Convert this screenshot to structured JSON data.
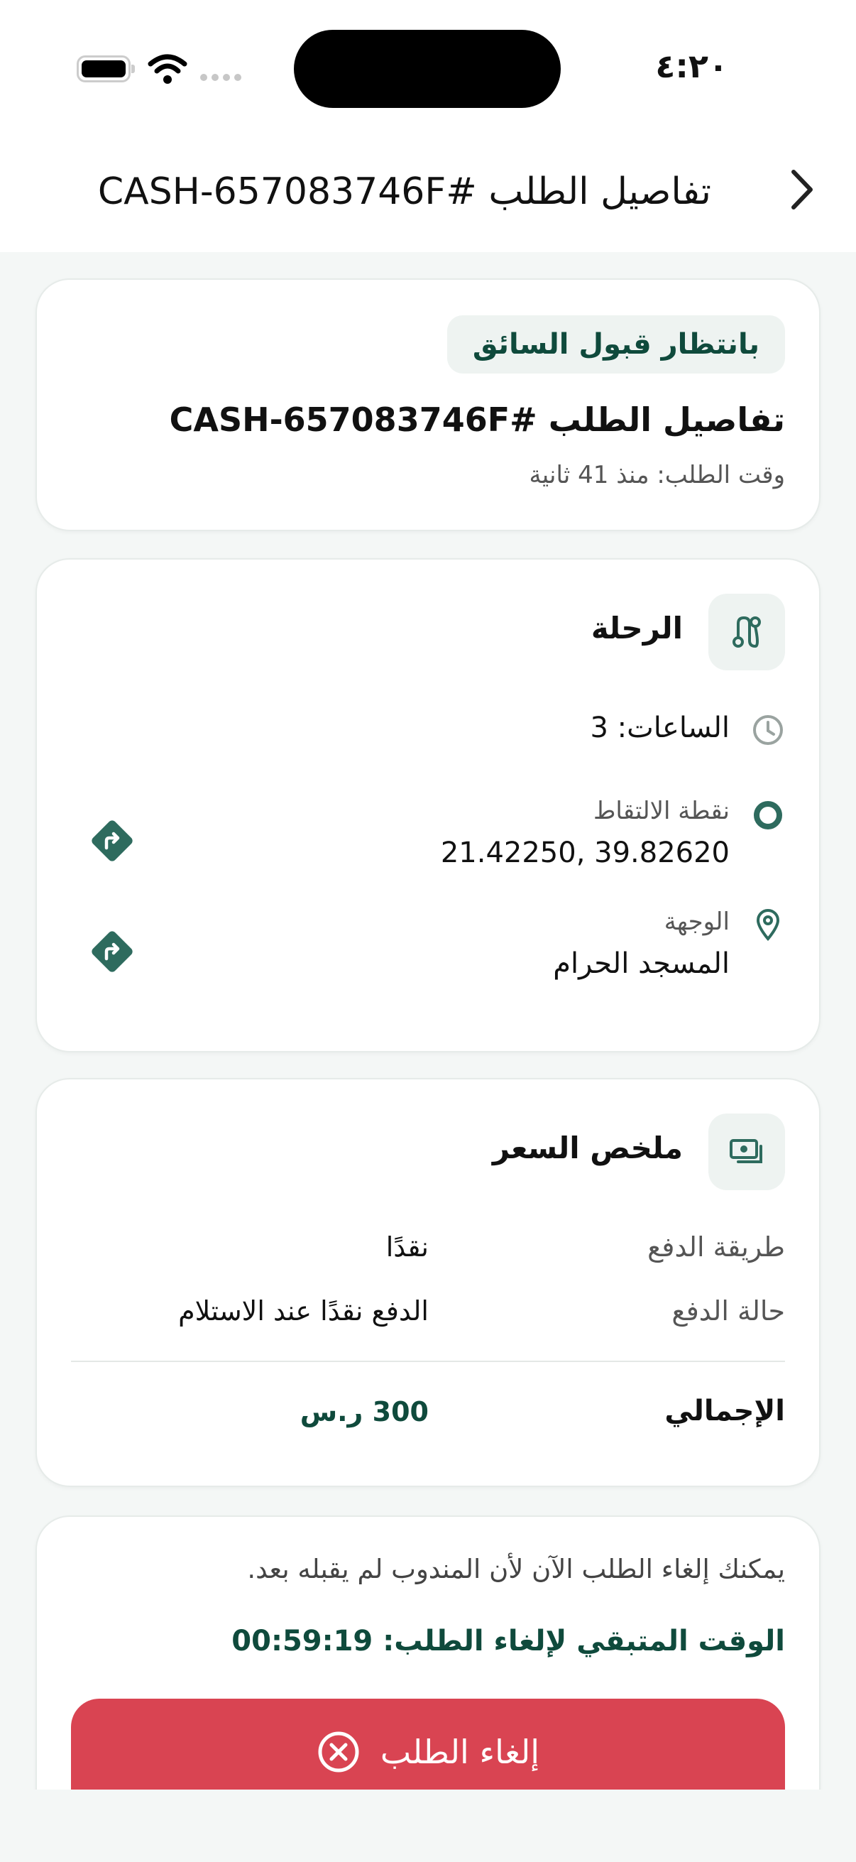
{
  "status_bar": {
    "time": "٤:٢٠"
  },
  "header": {
    "title": "تفاصيل الطلب #CASH-657083746F"
  },
  "order": {
    "status_badge": "بانتظار قبول السائق",
    "title": "تفاصيل الطلب #CASH-657083746F",
    "time": "وقت الطلب: منذ 41 ثانية"
  },
  "trip": {
    "title": "الرحلة",
    "hours": "الساعات: 3",
    "pickup_label": "نقطة الالتقاط",
    "pickup_value": "21.42250, 39.82620",
    "destination_label": "الوجهة",
    "destination_value": "المسجد الحرام"
  },
  "price": {
    "title": "ملخص السعر",
    "payment_method_label": "طريقة الدفع",
    "payment_method_value": "نقدًا",
    "payment_status_label": "حالة الدفع",
    "payment_status_value": "الدفع نقدًا عند الاستلام",
    "total_label": "الإجمالي",
    "total_value": "300 ر.س"
  },
  "cancel": {
    "note": "يمكنك إلغاء الطلب الآن لأن المندوب لم يقبله بعد.",
    "timer": "الوقت المتبقي لإلغاء الطلب: 00:59:19",
    "button_label": "إلغاء الطلب"
  },
  "colors": {
    "brand": "#0f4a3c",
    "accent": "#2e6b5e",
    "danger": "#d94452",
    "background": "#f4f7f6"
  },
  "icons": {
    "back": "chevron-right-icon",
    "trip": "route-icon",
    "hours": "clock-icon",
    "pickup": "circle-outline-icon",
    "destination": "map-pin-icon",
    "navigate": "turn-right-diamond-icon",
    "price": "cash-icon",
    "cancel": "x-circle-icon"
  }
}
